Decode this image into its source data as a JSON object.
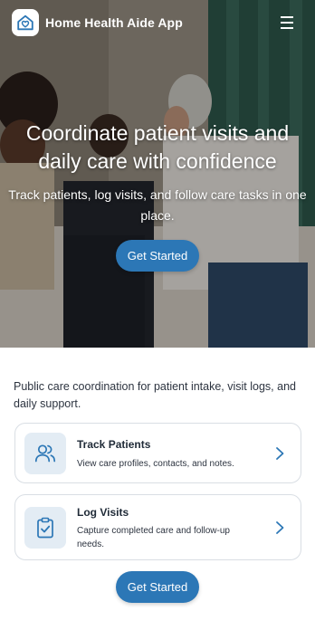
{
  "header": {
    "app_title": "Home Health Aide App",
    "logo_icon": "home-heart-icon",
    "menu_icon": "hamburger-menu-icon"
  },
  "hero": {
    "heading": "Coordinate patient visits and daily care with confidence",
    "subheading": "Track patients, log visits, and follow care tasks in one place.",
    "cta_label": "Get Started"
  },
  "intro": {
    "text": "Public care coordination for patient intake, visit logs, and daily support."
  },
  "features": [
    {
      "title": "Track Patients",
      "description": "View care profiles, contacts, and notes.",
      "icon": "users-icon"
    },
    {
      "title": "Log Visits",
      "description": "Capture completed care and follow-up needs.",
      "icon": "clipboard-check-icon"
    }
  ],
  "bottom_cta": {
    "label": "Get Started"
  },
  "colors": {
    "accent": "#2c77b6",
    "icon_bg": "#e3ecf4",
    "card_border": "#d9dee4"
  }
}
